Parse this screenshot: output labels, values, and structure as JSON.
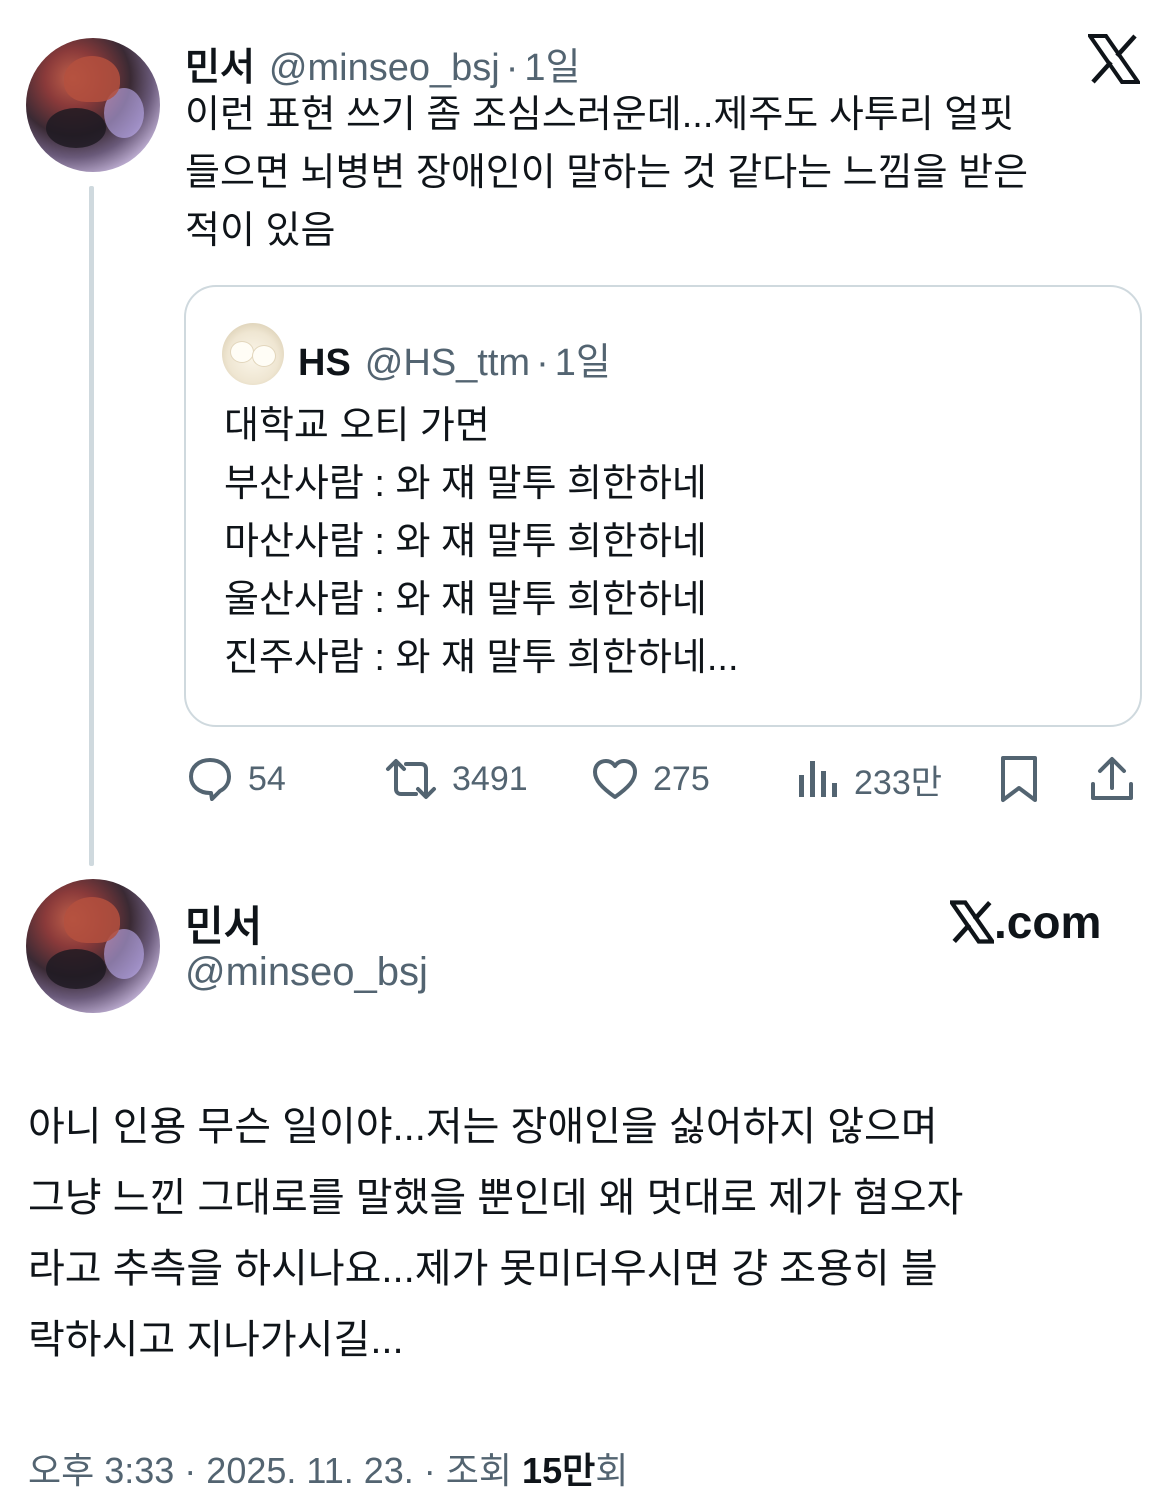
{
  "tweet": {
    "author_name": "민서",
    "handle": "@minseo_bsj",
    "separator": "·",
    "time": "1일",
    "lines": [
      "이런 표현 쓰기 좀 조심스러운데...제주도 사투리 얼핏",
      "들으면 뇌병변 장애인이 말하는 것 같다는 느낌을 받은",
      "적이 있음"
    ]
  },
  "quote": {
    "author_name": "HS",
    "handle": "@HS_ttm",
    "separator": "·",
    "time": "1일",
    "lines": [
      "대학교 오티 가면",
      "부산사람 : 와 쟤 말투 희한하네",
      "마산사람 : 와 쟤 말투 희한하네",
      "울산사람 : 와 쟤 말투 희한하네",
      "진주사람 : 와 쟤 말투 희한하네..."
    ]
  },
  "actions": {
    "replies": "54",
    "retweets": "3491",
    "likes": "275",
    "views": "233만"
  },
  "reply": {
    "author_name": "민서",
    "handle": "@minseo_bsj",
    "brand": ".com",
    "lines": [
      "아니 인용 무슨 일이야...저는 장애인을 싫어하지 않으며",
      "그냥 느낀 그대로를 말했을 뿐인데 왜 멋대로 제가 혐오자",
      "라고 추측을 하시나요...제가 못미더우시면 걍 조용히 블",
      "락하시고 지나가시길..."
    ],
    "timestamp": "오후 3:33 · 2025. 11. 23. · 조회 ",
    "views_count": "15만",
    "views_suffix": "회"
  },
  "icons": {
    "x_logo": "x-logo-icon",
    "reply": "speech-bubble-icon",
    "retweet": "retweet-arrows-icon",
    "like": "heart-icon",
    "views": "bar-chart-icon",
    "bookmark": "bookmark-icon",
    "share": "share-upload-icon"
  },
  "colors": {
    "text": "#0f1419",
    "muted": "#536471",
    "border": "#cfd9de"
  }
}
